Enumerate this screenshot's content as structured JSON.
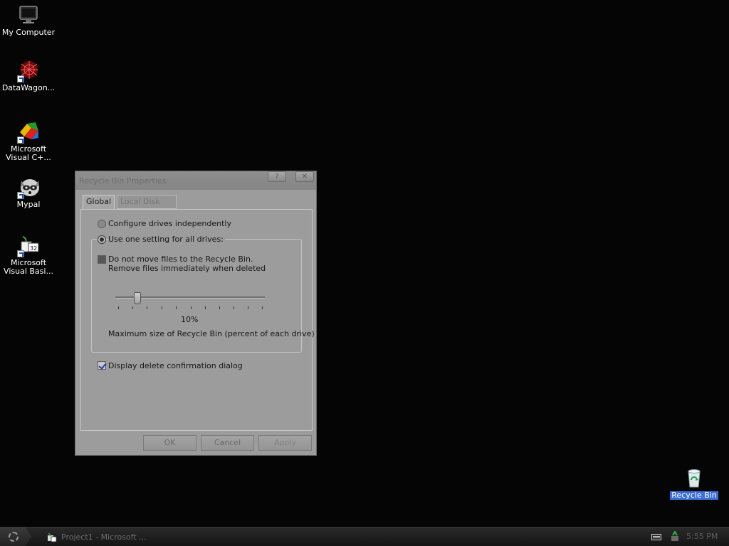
{
  "desktop": {
    "icons": [
      {
        "label": "My Computer",
        "icon": "computer-icon"
      },
      {
        "label": "DataWagon...",
        "icon": "datawagon-icon"
      },
      {
        "label": "Microsoft Visual C+...",
        "icon": "visual-cpp-icon"
      },
      {
        "label": "Mypal",
        "icon": "mypal-icon"
      },
      {
        "label": "Microsoft Visual Basi...",
        "icon": "visual-basic-icon"
      },
      {
        "label": "Recycle Bin",
        "icon": "recycle-bin-icon"
      }
    ]
  },
  "dialog": {
    "title": "Recycle Bin Properties",
    "help_label": "?",
    "close_label": "✕",
    "tabs": [
      {
        "label": "Global",
        "active": true
      },
      {
        "label": "Local Disk (C:)",
        "active": false
      }
    ],
    "configure_independently": "Configure drives independently",
    "use_one_setting": "Use one setting for all drives:",
    "do_not_move_line1": "Do not move files to the Recycle Bin.",
    "do_not_move_line2": "Remove files immediately when deleted",
    "slider_value": "10%",
    "slider_fraction": 0.1,
    "max_size_label": "Maximum size of Recycle Bin (percent of each drive)",
    "display_confirm": "Display delete confirmation dialog",
    "buttons": {
      "ok": "OK",
      "cancel": "Cancel",
      "apply": "Apply"
    }
  },
  "taskbar": {
    "task_label": "Project1 - Microsoft ...",
    "clock": "5:55 PM"
  },
  "colors": {
    "desktop_bg": "#050505",
    "dialog_bg": "#9c9c9c",
    "selection": "#3d6fd6"
  }
}
